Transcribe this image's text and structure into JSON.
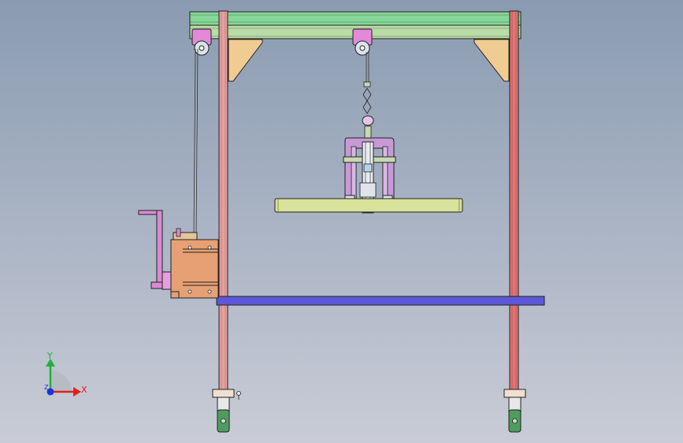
{
  "viewport": {
    "background_top": "#8a9bb1",
    "background_bottom": "#c9ccd6"
  },
  "colors": {
    "top_beam": "#86d69a",
    "lower_beam": "#b9dca8",
    "pulley": "#e28ad8",
    "gusset": "#f0cc92",
    "left_column": "#e6a0a0",
    "right_column": "#e27575",
    "ground_rail": "#5c58d8",
    "winch_body": "#e6a074",
    "crank_handle": "#d98ad2",
    "lifting_bar": "#d9e29a",
    "gripper_frame": "#c79ad6",
    "caster_wheel": "#4f9c5e",
    "x_axis": "#e02020",
    "y_axis": "#20b040",
    "z_axis": "#2030e0"
  },
  "triad": {
    "x_label": "X",
    "y_label": "Y",
    "z_label": "Z"
  },
  "icons": [
    "pulley",
    "winch-drum",
    "crank-handle",
    "eye-bolt",
    "chain-hook",
    "caster-wheel"
  ]
}
